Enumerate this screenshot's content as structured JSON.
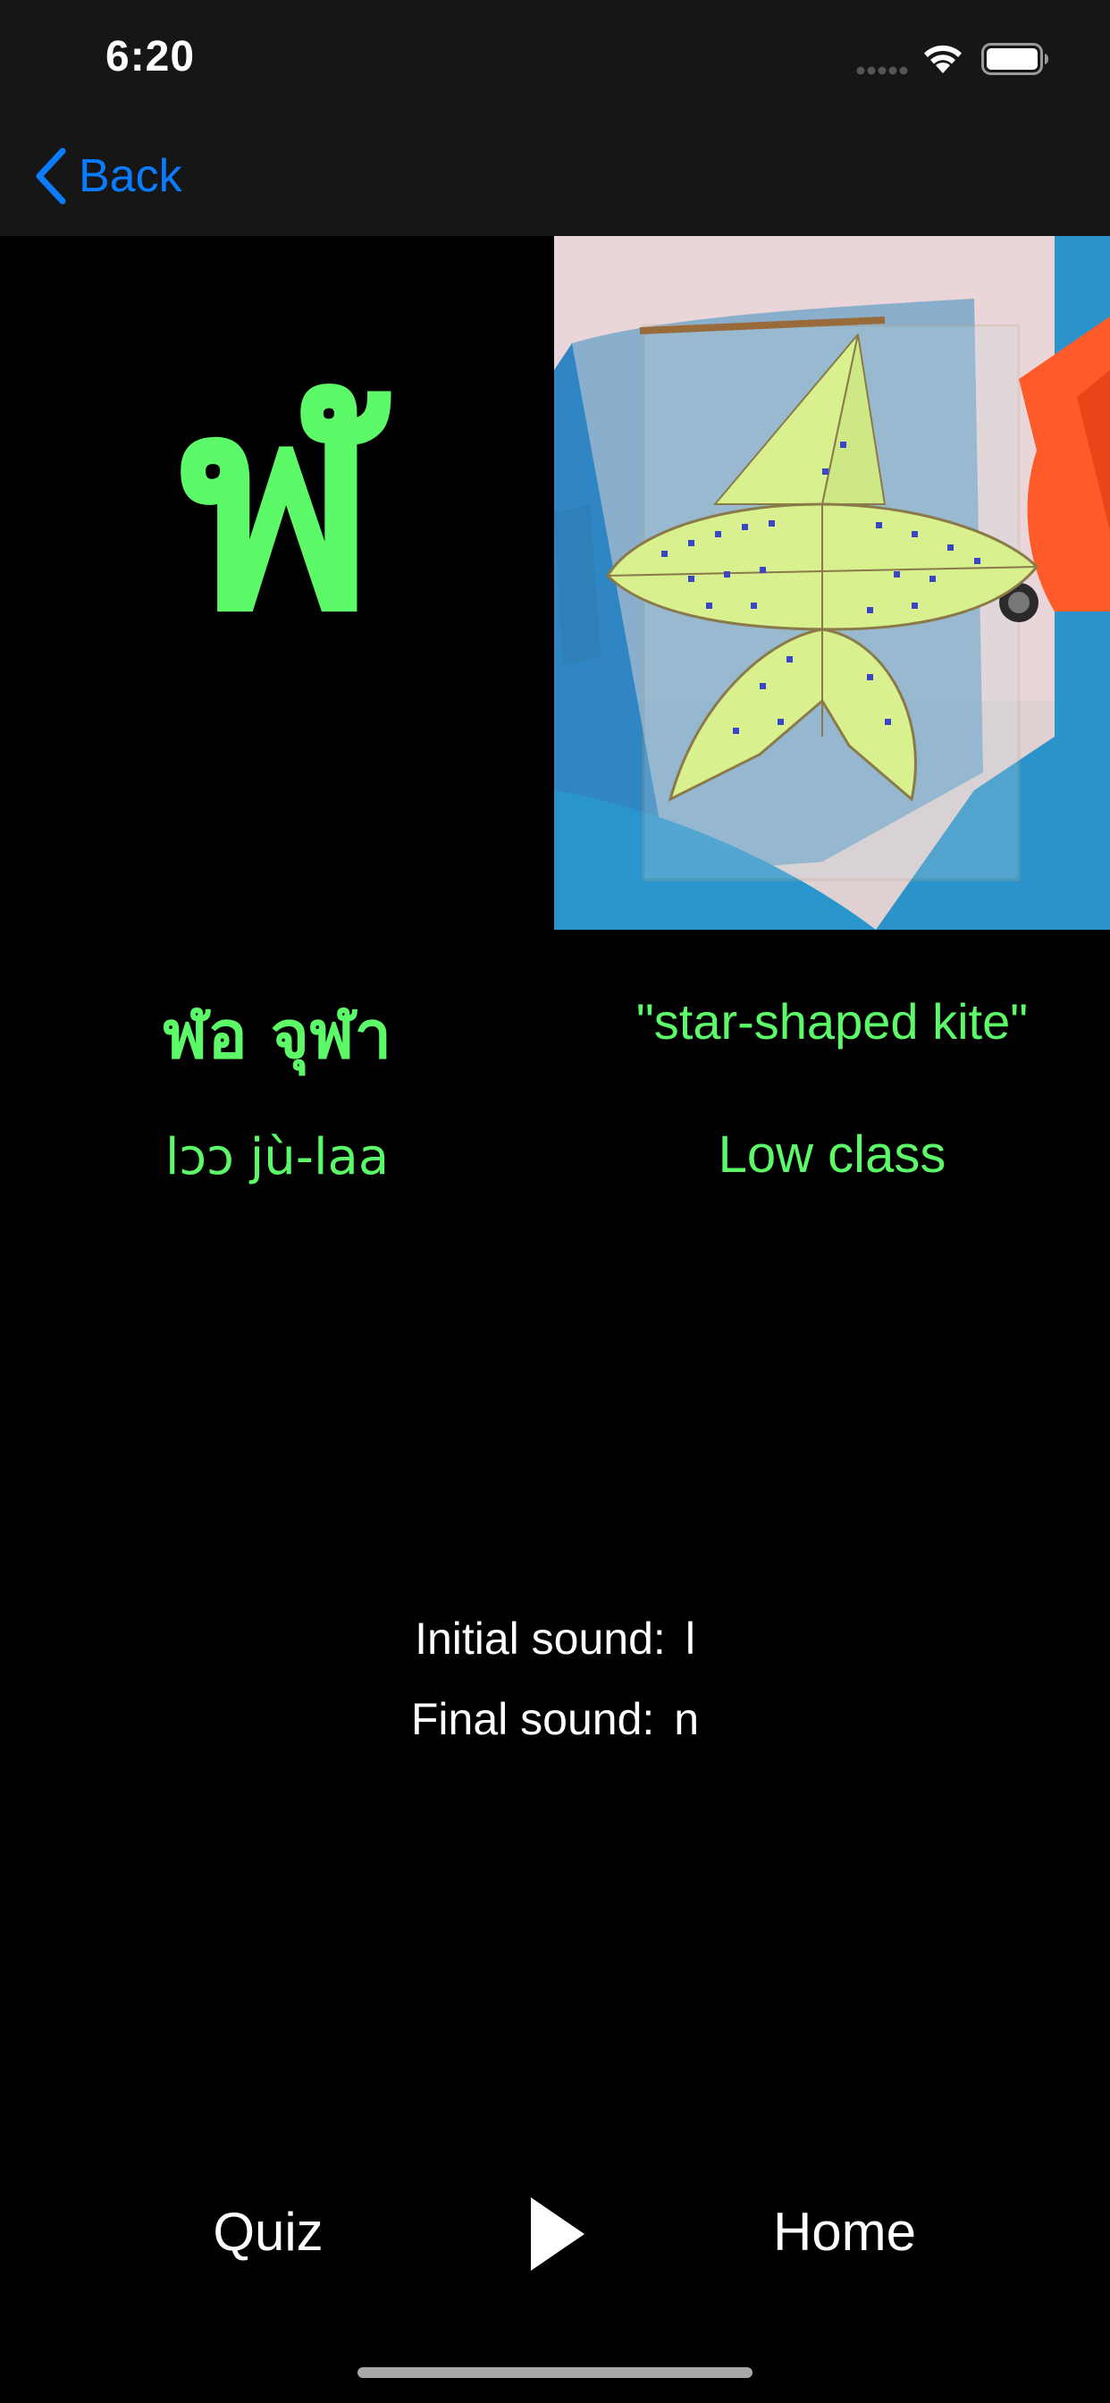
{
  "status_bar": {
    "time": "6:20"
  },
  "nav": {
    "back_label": "Back",
    "back_icon": "chevron-left-icon",
    "accent_color": "#0a7cff"
  },
  "letter": {
    "character": "ฬ",
    "name": "ฬอ จุฬา",
    "romanization": "lɔɔ jù-laa",
    "meaning": "\"star-shaped kite\"",
    "class": "Low class",
    "text_color": "#5cfa68"
  },
  "sounds": {
    "initial_label": "Initial sound:",
    "initial_value": "l",
    "final_label": "Final sound:",
    "final_value": "n"
  },
  "toolbar": {
    "quiz_label": "Quiz",
    "play_icon": "play-icon",
    "home_label": "Home"
  }
}
